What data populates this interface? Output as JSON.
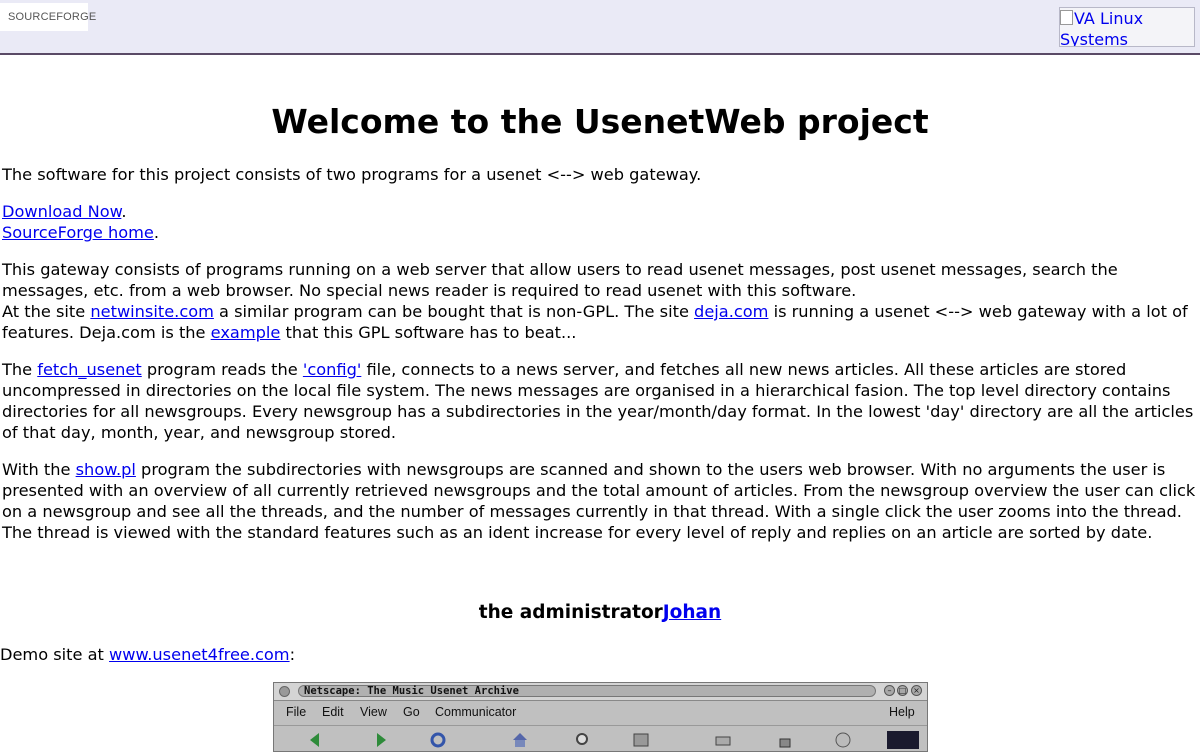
{
  "header": {
    "logo_text": "SOURCEFORGE",
    "sponsor_alt": "VA Linux Systems"
  },
  "title": "Welcome to the UsenetWeb project",
  "intro": "The software for this project consists of two programs for a usenet <--> web gateway.",
  "links": {
    "download": "Download Now",
    "download_tail": ".",
    "sf_home": "SourceForge home",
    "sf_home_tail": "."
  },
  "gateway": {
    "line1": "This gateway consists of programs running on a web server that allow users to read usenet messages, post usenet messages, search the messages, etc. from a web browser. No special news reader is required to read usenet with this software.",
    "line2_a": "At the site ",
    "netwinsite": "netwinsite.com",
    "line2_b": " a similar program can be bought that is non-GPL. The site ",
    "deja": "deja.com",
    "line2_c": " is running a usenet <--> web gateway with a lot of features. Deja.com is the ",
    "example": "example",
    "line2_d": " that this GPL software has to beat..."
  },
  "fetch": {
    "a": "The ",
    "fetch_link": "fetch_usenet",
    "b": " program reads the ",
    "config_link": "'config'",
    "c": " file, connects to a news server, and fetches all new news articles. All these articles are stored uncompressed in directories on the local file system. The news messages are organised in a hierarchical fasion. The top level directory contains directories for all newsgroups. Every newsgroup has a subdirectories in the year/month/day format. In the lowest 'day' directory are all the articles of that day, month, year, and newsgroup stored."
  },
  "show": {
    "a": "With the ",
    "show_link": "show.pl",
    "b": " program the subdirectories with newsgroups are scanned and shown to the users web browser. With no arguments the user is presented with an overview of all currently retrieved newsgroups and the total amount of articles. From the newsgroup overview the user can click on a newsgroup and see all the threads, and the number of messages currently in that thread. With a single click the user zooms into the thread. The thread is viewed with the standard features such as an ident increase for every level of reply and replies on an article are sorted by date."
  },
  "admin": {
    "text": "the administrator",
    "link": "Johan"
  },
  "demo": {
    "a": "Demo site at ",
    "link": "www.usenet4free.com",
    "b": ":"
  },
  "netscape": {
    "title": "Netscape: The Music Usenet Archive",
    "menu": [
      "File",
      "Edit",
      "View",
      "Go",
      "Communicator"
    ],
    "help": "Help"
  }
}
